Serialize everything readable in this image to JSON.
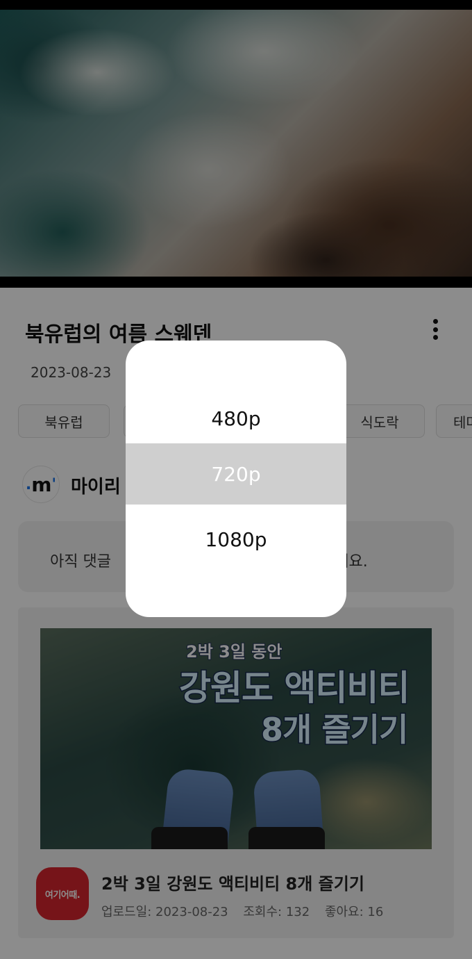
{
  "video": {
    "description_icon": "video-player"
  },
  "header": {
    "title": "북유럽의 여름 스웨덴",
    "date": "2023-08-23",
    "more_icon": "more-vertical-icon"
  },
  "tags": [
    "북유럽",
    "",
    "",
    "식도락",
    "테마"
  ],
  "channel": {
    "logo_text": "m",
    "name": "마이리"
  },
  "comments": {
    "empty_text_left": "아직 댓글",
    "empty_text_right": "주세요."
  },
  "recommended": {
    "thumbnail": {
      "line1": "2박 3일 동안",
      "line2": "강원도 액티비티",
      "line3": "8개 즐기기"
    },
    "app_icon_text": "여기어때.",
    "title": "2박 3일 강원도 액티비티 8개 즐기기",
    "upload_label": "업로드일: 2023-08-23",
    "views_label": "조회수: 132",
    "likes_label": "좋아요: 16"
  },
  "quality_dialog": {
    "options": [
      {
        "label": "480p",
        "selected": false
      },
      {
        "label": "720p",
        "selected": true
      },
      {
        "label": "1080p",
        "selected": false
      }
    ]
  },
  "colors": {
    "overlay": "#000000",
    "selected_option_bg": "#cfcfcf",
    "app_icon_bg": "#d8262e",
    "channel_accent": "#1a73e8"
  }
}
